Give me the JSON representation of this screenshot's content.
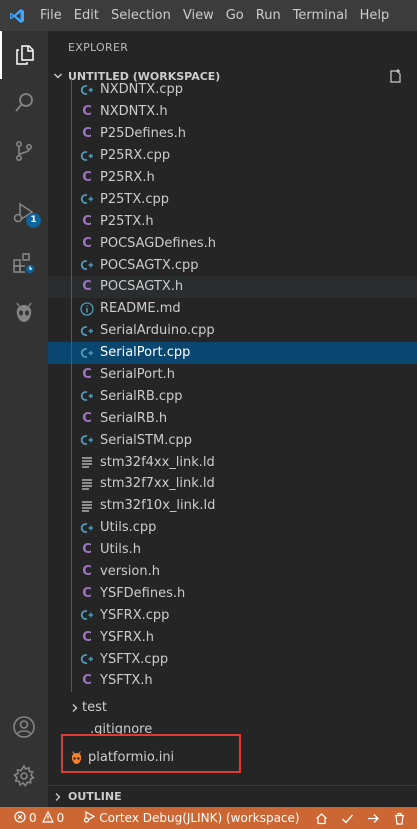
{
  "menu": [
    "File",
    "Edit",
    "Selection",
    "View",
    "Go",
    "Run",
    "Terminal",
    "Help"
  ],
  "activity": {
    "run_badge": "1"
  },
  "explorer": {
    "title": "EXPLORER",
    "workspace_title": "UNTITLED (WORKSPACE)",
    "files": [
      {
        "name": "NXDNTX.cpp",
        "type": "cpp"
      },
      {
        "name": "NXDNTX.h",
        "type": "c"
      },
      {
        "name": "P25Defines.h",
        "type": "c"
      },
      {
        "name": "P25RX.cpp",
        "type": "cpp"
      },
      {
        "name": "P25RX.h",
        "type": "c"
      },
      {
        "name": "P25TX.cpp",
        "type": "cpp"
      },
      {
        "name": "P25TX.h",
        "type": "c"
      },
      {
        "name": "POCSAGDefines.h",
        "type": "c"
      },
      {
        "name": "POCSAGTX.cpp",
        "type": "cpp"
      },
      {
        "name": "POCSAGTX.h",
        "type": "c",
        "state": "hover"
      },
      {
        "name": "README.md",
        "type": "info"
      },
      {
        "name": "SerialArduino.cpp",
        "type": "cpp"
      },
      {
        "name": "SerialPort.cpp",
        "type": "cpp",
        "state": "selected"
      },
      {
        "name": "SerialPort.h",
        "type": "c"
      },
      {
        "name": "SerialRB.cpp",
        "type": "cpp"
      },
      {
        "name": "SerialRB.h",
        "type": "c"
      },
      {
        "name": "SerialSTM.cpp",
        "type": "cpp"
      },
      {
        "name": "stm32f4xx_link.ld",
        "type": "text"
      },
      {
        "name": "stm32f7xx_link.ld",
        "type": "text"
      },
      {
        "name": "stm32f10x_link.ld",
        "type": "text"
      },
      {
        "name": "Utils.cpp",
        "type": "cpp"
      },
      {
        "name": "Utils.h",
        "type": "c"
      },
      {
        "name": "version.h",
        "type": "c"
      },
      {
        "name": "YSFDefines.h",
        "type": "c"
      },
      {
        "name": "YSFRX.cpp",
        "type": "cpp"
      },
      {
        "name": "YSFRX.h",
        "type": "c"
      },
      {
        "name": "YSFTX.cpp",
        "type": "cpp"
      },
      {
        "name": "YSFTX.h",
        "type": "c"
      }
    ],
    "folder_test": "test",
    "gitignore": ".gitignore",
    "platformio": "platformio.ini",
    "outline_title": "OUTLINE"
  },
  "statusbar": {
    "errors": "0",
    "warnings": "0",
    "debug": "Cortex Debug(JLINK) (workspace)"
  },
  "colors": {
    "statusbar": "#cc6633",
    "selection": "#094771",
    "highlight_box": "#e03a32"
  }
}
